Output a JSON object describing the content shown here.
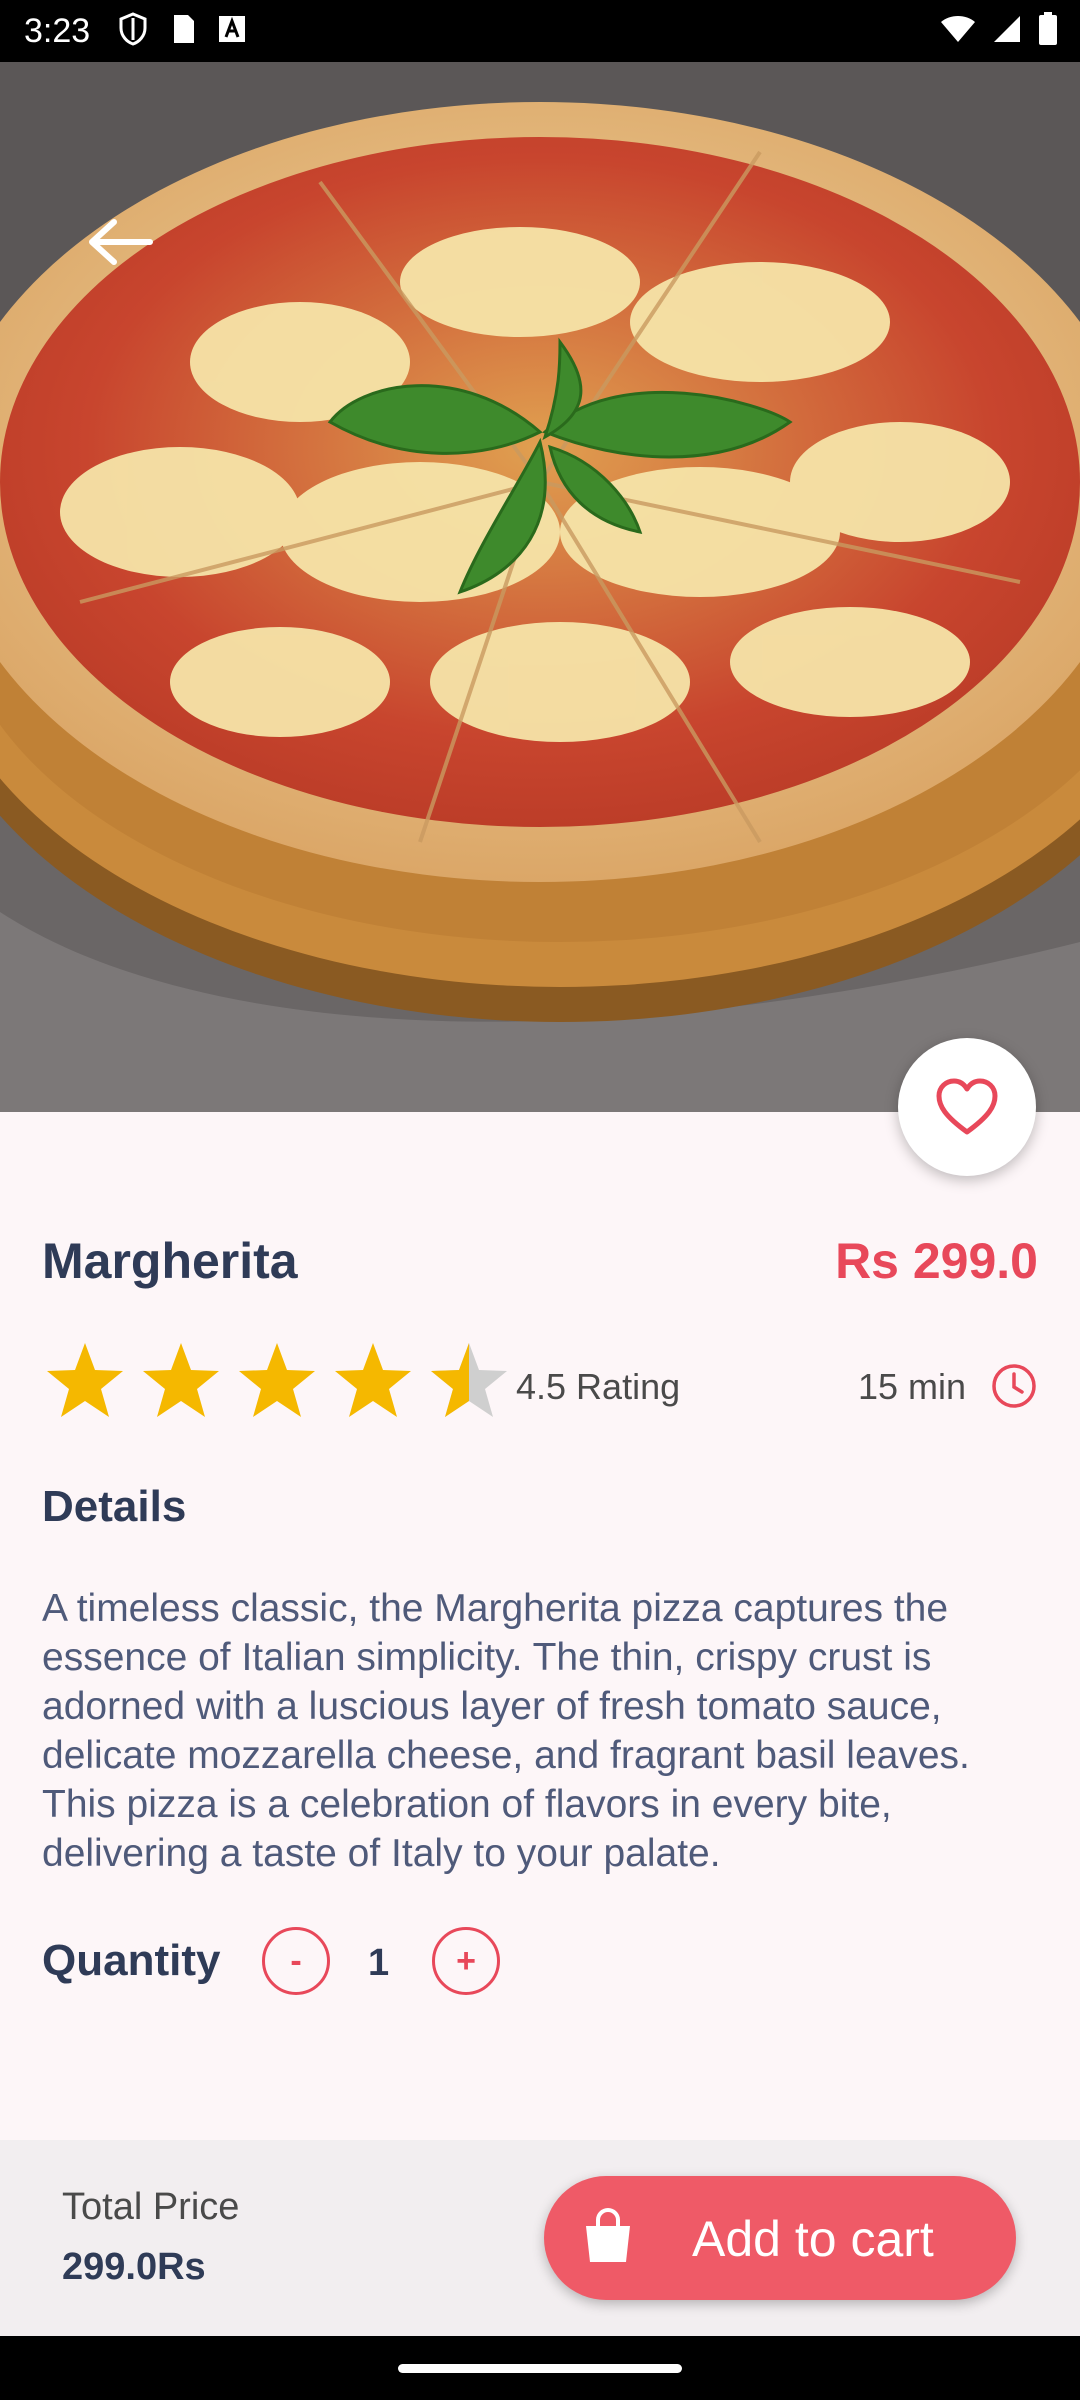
{
  "status_bar": {
    "time": "3:23"
  },
  "product": {
    "name": "Margherita",
    "price": "Rs 299.0",
    "rating_value": 4.5,
    "rating_label": "4.5 Rating",
    "prep_time": "15 min",
    "details_heading": "Details",
    "description": "A timeless classic, the Margherita pizza captures the essence of Italian simplicity. The thin, crispy crust is adorned with a luscious layer of fresh tomato sauce, delicate mozzarella cheese, and fragrant basil leaves. This pizza is a celebration of flavors in every bite, delivering a taste of Italy to your palate."
  },
  "quantity": {
    "label": "Quantity",
    "minus": "-",
    "value": "1",
    "plus": "+"
  },
  "footer": {
    "total_label": "Total Price",
    "total_value": "299.0Rs",
    "add_to_cart": "Add to cart"
  },
  "colors": {
    "accent": "#e8485a",
    "heading": "#2f3b57",
    "star": "#f5b800",
    "background": "#fdf6f8"
  },
  "icons": [
    "back-arrow-icon",
    "heart-icon",
    "star-icon",
    "clock-icon",
    "shopping-bag-icon"
  ]
}
